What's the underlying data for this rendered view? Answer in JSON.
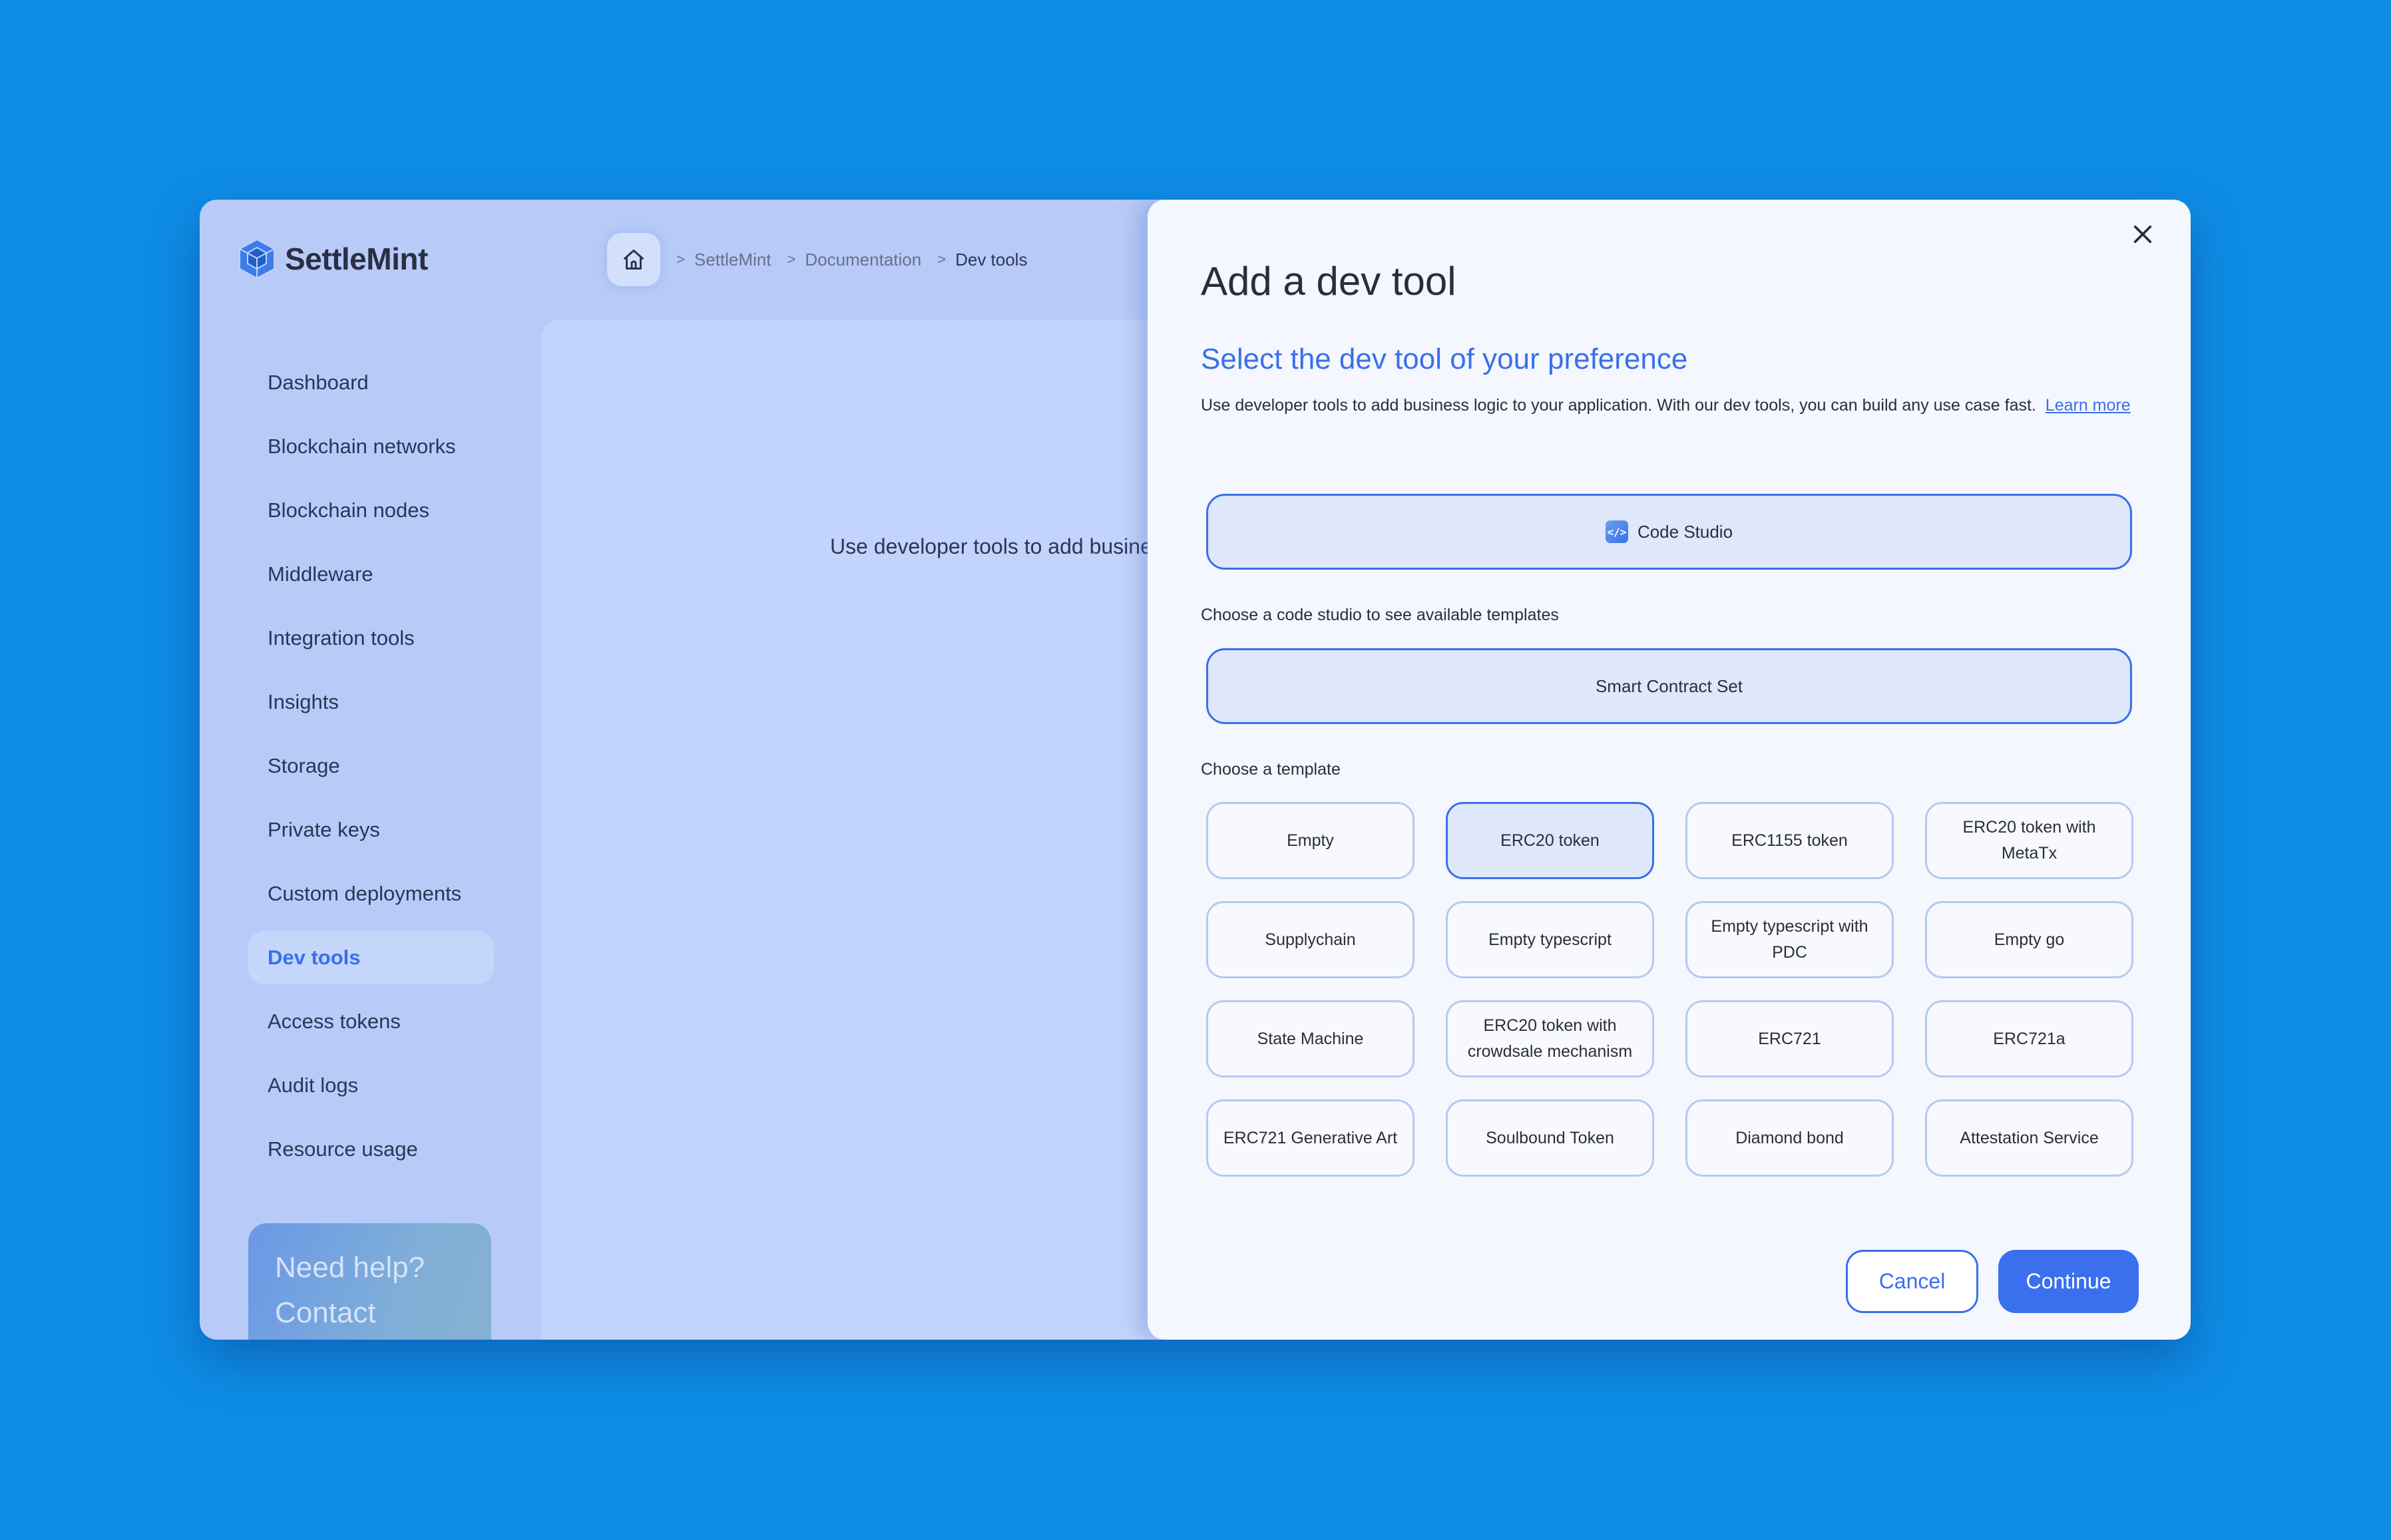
{
  "app": {
    "brand": "SettleMint",
    "colors": {
      "accent": "#3A6FEA",
      "background": "#0E8CE4",
      "window": "#B8CBF8",
      "modal": "#F4F7FE"
    }
  },
  "breadcrumb": {
    "home_icon": "home-icon",
    "items": [
      {
        "label": "SettleMint"
      },
      {
        "label": "Documentation"
      },
      {
        "label": "Dev tools"
      }
    ],
    "separator": ">"
  },
  "sidebar": {
    "items": [
      {
        "label": "Dashboard",
        "active": false
      },
      {
        "label": "Blockchain networks",
        "active": false
      },
      {
        "label": "Blockchain nodes",
        "active": false
      },
      {
        "label": "Middleware",
        "active": false
      },
      {
        "label": "Integration tools",
        "active": false
      },
      {
        "label": "Insights",
        "active": false
      },
      {
        "label": "Storage",
        "active": false
      },
      {
        "label": "Private keys",
        "active": false
      },
      {
        "label": "Custom deployments",
        "active": false
      },
      {
        "label": "Dev tools",
        "active": true
      },
      {
        "label": "Access tokens",
        "active": false
      },
      {
        "label": "Audit logs",
        "active": false
      },
      {
        "label": "Resource usage",
        "active": false
      }
    ],
    "help_card": {
      "line1": "Need help?",
      "line2": "Contact"
    }
  },
  "main": {
    "intro_text": "Use developer tools to add busine"
  },
  "modal": {
    "title": "Add a dev tool",
    "subtitle": "Select the dev tool of your preference",
    "description": "Use developer tools to add business logic to your application. With our dev tools, you can build any use case fast.",
    "learn_more": "Learn more",
    "code_studio": {
      "label": "Code Studio",
      "icon": "code-icon",
      "selected": true
    },
    "code_studio_hint": "Choose a code studio to see available templates",
    "template_set": {
      "label": "Smart Contract Set",
      "selected": true
    },
    "template_label": "Choose a template",
    "templates": [
      {
        "label": "Empty",
        "selected": false
      },
      {
        "label": "ERC20 token",
        "selected": true
      },
      {
        "label": "ERC1155 token",
        "selected": false
      },
      {
        "label": "ERC20 token with MetaTx",
        "selected": false
      },
      {
        "label": "Supplychain",
        "selected": false
      },
      {
        "label": "Empty typescript",
        "selected": false
      },
      {
        "label": "Empty typescript with PDC",
        "selected": false
      },
      {
        "label": "Empty go",
        "selected": false
      },
      {
        "label": "State Machine",
        "selected": false
      },
      {
        "label": "ERC20 token with crowdsale mechanism",
        "selected": false
      },
      {
        "label": "ERC721",
        "selected": false
      },
      {
        "label": "ERC721a",
        "selected": false
      },
      {
        "label": "ERC721 Generative Art",
        "selected": false
      },
      {
        "label": "Soulbound Token",
        "selected": false
      },
      {
        "label": "Diamond bond",
        "selected": false
      },
      {
        "label": "Attestation Service",
        "selected": false
      }
    ],
    "cancel_label": "Cancel",
    "continue_label": "Continue"
  }
}
